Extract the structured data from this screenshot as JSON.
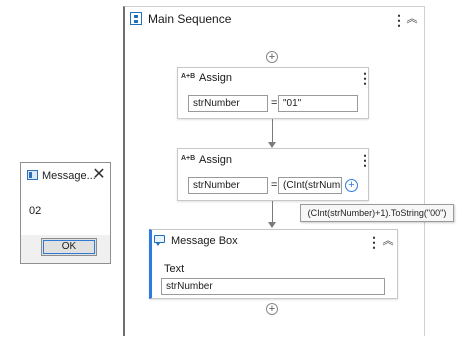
{
  "dialog": {
    "caption": "Message...",
    "close_glyph": "✕",
    "message": "02",
    "ok_label": "OK"
  },
  "sequence": {
    "title": "Main Sequence",
    "kebab": "⋮",
    "collapse": "︽"
  },
  "assign1": {
    "icon_text": "A+B",
    "title": "Assign",
    "kebab": "⋮",
    "to": "strNumber",
    "eq": "=",
    "value": "\"01\""
  },
  "assign2": {
    "icon_text": "A+B",
    "title": "Assign",
    "kebab": "⋮",
    "to": "strNumber",
    "eq": "=",
    "value": "(CInt(strNumbe",
    "add_glyph": "+"
  },
  "tooltip": "(CInt(strNumber)+1).ToString(\"00\")",
  "message_box": {
    "title": "Message Box",
    "kebab": "⋮",
    "collapse": "︽",
    "text_label": "Text",
    "text_value": "strNumber"
  },
  "add_glyph": "+",
  "colors": {
    "accent": "#2d7be0",
    "frame_border": "#6e6e6e"
  }
}
